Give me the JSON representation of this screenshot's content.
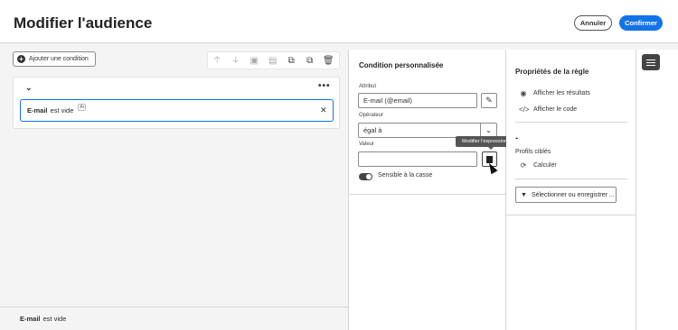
{
  "header": {
    "title": "Modifier l'audience",
    "cancel_label": "Annuler",
    "confirm_label": "Confirmer",
    "accent_color": "#1473e6"
  },
  "canvas": {
    "add_condition_label": "Ajouter une condition",
    "toolbar_icons": [
      "arrow-up-icon",
      "arrow-down-icon",
      "group-icon",
      "ungroup-icon",
      "copy-icon",
      "duplicate-icon",
      "trash-icon"
    ],
    "condition": {
      "field": "E-mail",
      "operator_text": "est vide",
      "badge": "Ar"
    }
  },
  "footer": {
    "field": "E-mail",
    "text": "est vide"
  },
  "condition_panel": {
    "title": "Condition personnalisée",
    "attribute_label": "Attribut",
    "attribute_value": "E-mail (@email)",
    "operator_label": "Opérateur",
    "operator_value": "égal à",
    "value_label": "Valeur",
    "value_value": "",
    "tooltip": "Modifier l'expression",
    "case_sensitive_label": "Sensible à la casse",
    "case_sensitive_on": true
  },
  "properties_panel": {
    "title": "Propriétés de la règle",
    "show_results": "Afficher les résultats",
    "show_code": "Afficher le code",
    "count_value": "-",
    "targeted_profiles_label": "Profils ciblés",
    "calculate_label": "Calculer",
    "select_save_label": "Sélectionner ou enregistrer ..."
  }
}
